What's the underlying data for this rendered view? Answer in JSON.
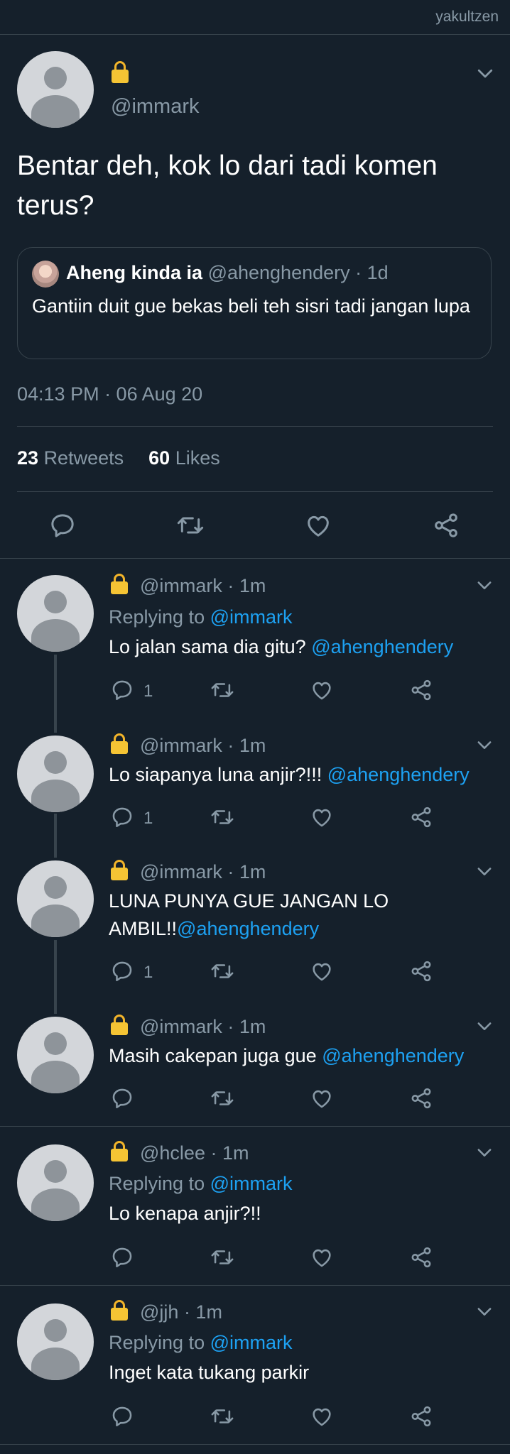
{
  "watermark": "yakultzen",
  "tweet": {
    "handle": "@immark",
    "text": "Bentar deh, kok lo dari tadi komen terus?",
    "quote": {
      "name": "Aheng kinda ia",
      "handle": "@ahenghendery",
      "time": "· 1d",
      "text": "Gantiin duit gue bekas beli teh sisri tadi jangan lupa"
    },
    "timestamp": "04:13 PM · 06 Aug 20",
    "retweets_count": "23",
    "retweets_label": "Retweets",
    "likes_count": "60",
    "likes_label": "Likes"
  },
  "replies": [
    {
      "handle": "@immark",
      "time": "· 1m",
      "replying_label": "Replying to",
      "replying_to": "@immark",
      "text": "Lo jalan sama dia gitu?",
      "mention": "@ahenghendery",
      "reply_count": "1"
    },
    {
      "handle": "@immark",
      "time": "· 1m",
      "text": "Lo siapanya luna anjir?!!!",
      "mention": "@ahenghendery",
      "reply_count": "1"
    },
    {
      "handle": "@immark",
      "time": "· 1m",
      "text_line1": "LUNA PUNYA GUE JANGAN LO",
      "text_line2": "AMBIL!!",
      "mention": "@ahenghendery",
      "reply_count": "1"
    },
    {
      "handle": "@immark",
      "time": "· 1m",
      "text": "Masih cakepan juga gue",
      "mention": "@ahenghendery"
    },
    {
      "handle": "@hclee",
      "time": "· 1m",
      "replying_label": "Replying to",
      "replying_to": "@immark",
      "text": "Lo kenapa anjir?!!"
    },
    {
      "handle": "@jjh",
      "time": "· 1m",
      "replying_label": "Replying to",
      "replying_to": "@immark",
      "text": "Inget kata tukang parkir"
    }
  ],
  "colors": {
    "background": "#15202b",
    "text_muted": "#8899a6",
    "link": "#1da1f2",
    "divider": "#38444d",
    "lock": "#f5c434"
  },
  "icons": [
    "lock-icon",
    "chevron-down-icon",
    "reply-icon",
    "retweet-icon",
    "like-icon",
    "share-icon"
  ]
}
